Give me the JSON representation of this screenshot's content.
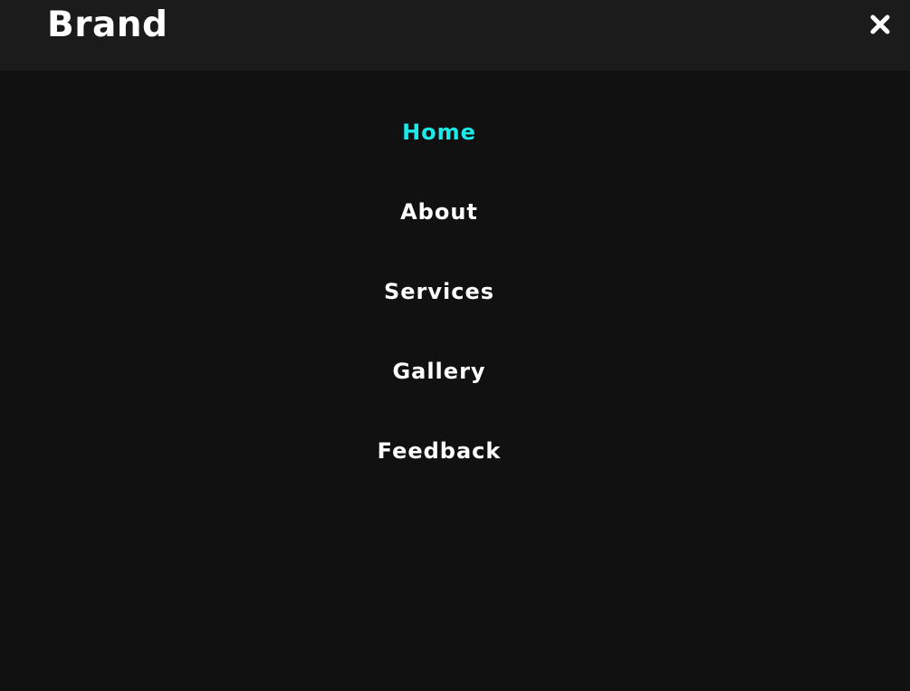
{
  "header": {
    "brand": "Brand",
    "close_icon": "close-icon"
  },
  "nav": {
    "items": [
      {
        "label": "Home",
        "active": true
      },
      {
        "label": "About",
        "active": false
      },
      {
        "label": "Services",
        "active": false
      },
      {
        "label": "Gallery",
        "active": false
      },
      {
        "label": "Feedback",
        "active": false
      }
    ]
  },
  "colors": {
    "background": "#111111",
    "header_background": "#1b1b1b",
    "text": "#ffffff",
    "accent": "#1de9e9"
  }
}
